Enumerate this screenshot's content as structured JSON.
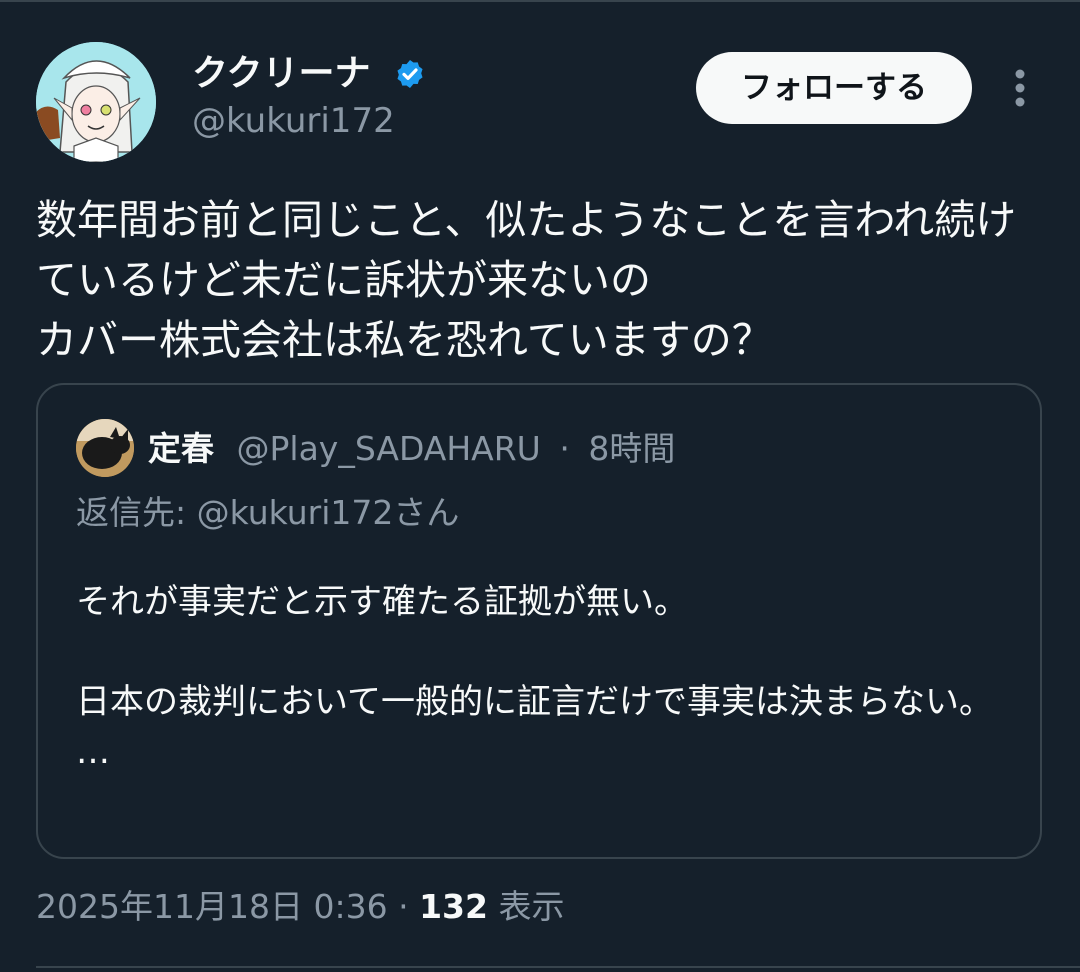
{
  "author": {
    "name": "ククリーナ",
    "handle": "@kukuri172",
    "verified": true,
    "avatar": "anime-avatar-white-hair"
  },
  "actions": {
    "follow_label": "フォローする",
    "more_icon": "more-vertical-icon"
  },
  "tweet": {
    "text": "数年間お前と同じこと、似たようなことを言われ続けているけど未だに訴状が来ないの\nカバー株式会社は私を恐れていますの？"
  },
  "quoted": {
    "name": "定春",
    "handle": "@Play_SADAHARU",
    "separator": "·",
    "time": "8時間",
    "reply_to": "返信先: @kukuri172さん",
    "body": "それが事実だと示す確たる証拠が無い。\n\n日本の裁判において一般的に証言だけで事実は決まらない。\n…",
    "avatar": "black-cat-avatar"
  },
  "footer": {
    "timestamp": "2025年11月18日 0:36",
    "separator": "·",
    "views_count": "132",
    "views_label": "表示"
  },
  "colors": {
    "background": "#15202b",
    "text": "#f7f9f9",
    "secondary_text": "#8b98a5",
    "border": "#38444d",
    "verified_blue": "#1d9bf0"
  }
}
